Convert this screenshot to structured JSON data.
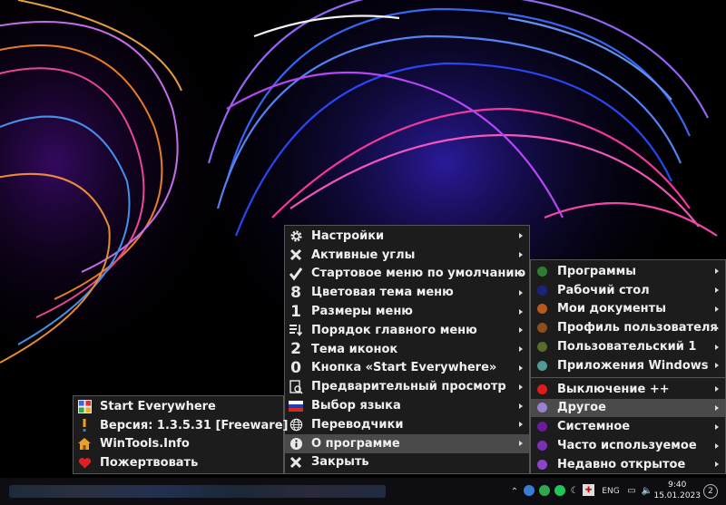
{
  "main_menu": {
    "items": [
      {
        "label": "Настройки",
        "icon": "gear-icon",
        "submenu": true
      },
      {
        "label": "Активные углы",
        "icon": "close-x-icon",
        "submenu": true
      },
      {
        "label": "Стартовое меню по умолчанию",
        "icon": "checkmark-icon",
        "submenu": true
      },
      {
        "label": "Цветовая тема меню",
        "icon": "digit-8-icon",
        "glyph": "8",
        "submenu": true
      },
      {
        "label": "Размеры меню",
        "icon": "digit-1-icon",
        "glyph": "1",
        "submenu": true
      },
      {
        "label": "Порядок главного меню",
        "icon": "sort-list-icon",
        "submenu": true
      },
      {
        "label": "Тема иконок",
        "icon": "digit-2-icon",
        "glyph": "2",
        "submenu": true
      },
      {
        "label": "Кнопка «Start Everywhere»",
        "icon": "digit-0-icon",
        "glyph": "0",
        "submenu": true
      },
      {
        "label": "Предварительный просмотр",
        "icon": "preview-icon",
        "submenu": true
      },
      {
        "label": "Выбор языка",
        "icon": "russian-flag-icon",
        "submenu": true
      },
      {
        "label": "Переводчики",
        "icon": "globe-icon",
        "submenu": true
      },
      {
        "label": "О программе",
        "icon": "info-icon",
        "submenu": true,
        "selected": true
      },
      {
        "label": "Закрыть",
        "icon": "close-icon",
        "submenu": false
      }
    ]
  },
  "right_menu": {
    "group1": [
      {
        "label": "Программы",
        "color": "#2e7d32"
      },
      {
        "label": "Рабочий стол",
        "color": "#1a237e"
      },
      {
        "label": "Мои документы",
        "color": "#b35a1f"
      },
      {
        "label": "Профиль пользователя",
        "color": "#8d4e1c"
      },
      {
        "label": "Пользовательский 1",
        "color": "#5a6b2c"
      },
      {
        "label": "Приложения Windows",
        "color": "#4f9b94"
      }
    ],
    "group2": [
      {
        "label": "Выключение ++",
        "color": "#e01b1b"
      },
      {
        "label": "Другое",
        "color": "#9b7fd0",
        "selected": true
      },
      {
        "label": "Системное",
        "color": "#6a1b9a"
      },
      {
        "label": "Часто используемое",
        "color": "#7b2fb5"
      },
      {
        "label": "Недавно открытое",
        "color": "#8e44c9"
      }
    ]
  },
  "about_menu": {
    "items": [
      {
        "label": "Start Everywhere",
        "icon": "app-logo-icon"
      },
      {
        "label": "Версия: 1.3.5.31 [Freeware]",
        "icon": "exclamation-icon"
      },
      {
        "label": "WinTools.Info",
        "icon": "home-icon"
      },
      {
        "label": "Пожертвовать",
        "icon": "heart-icon"
      }
    ]
  },
  "taskbar": {
    "lang": "ENG",
    "time": "9:40",
    "date": "15.01.2023",
    "notifications": "2"
  },
  "colors": {
    "menu_bg": "#1c1c1c",
    "selected_bg": "#4a4a4a",
    "menu_border": "#555555"
  }
}
